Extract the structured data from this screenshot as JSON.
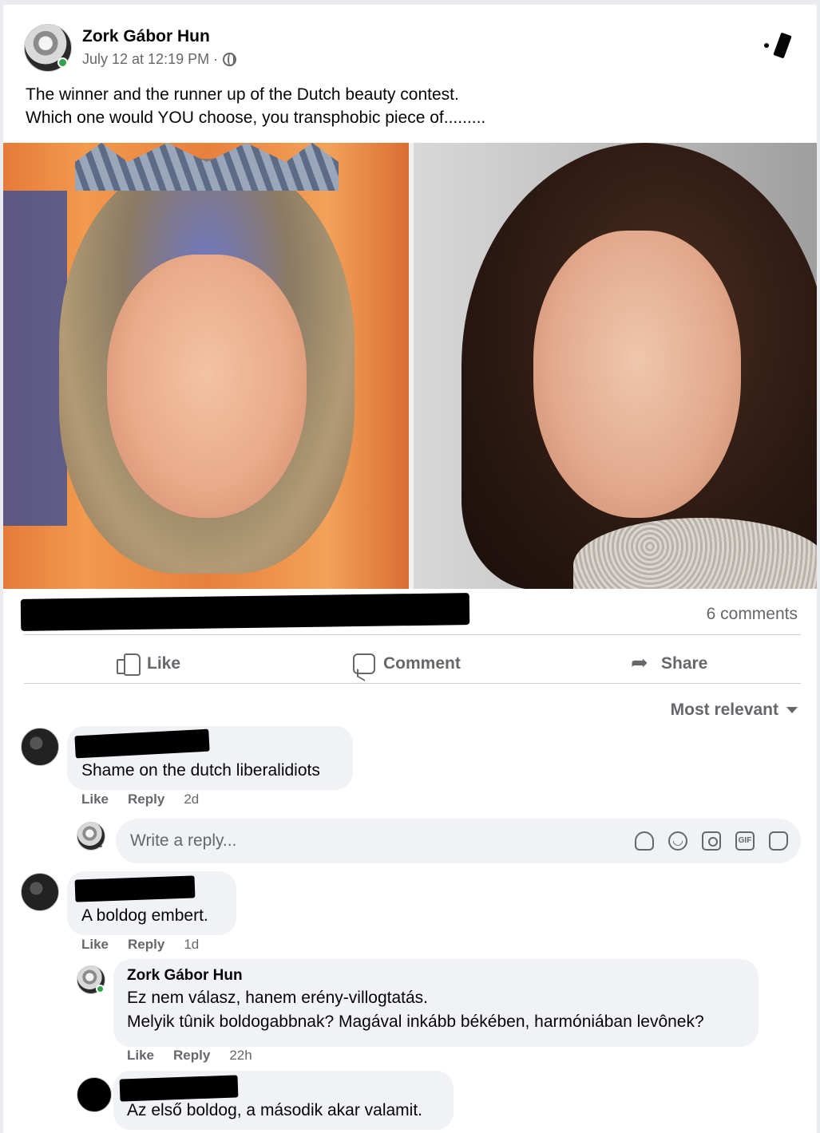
{
  "post": {
    "author": "Zork Gábor Hun",
    "timestamp": "July 12 at 12:19 PM ·",
    "privacy_icon": "globe-icon",
    "text_line1": "The winner and the runner up of the Dutch beauty contest.",
    "text_line2": "Which one would YOU choose, you transphobic piece of.........",
    "comments_count": "6 comments"
  },
  "actions": {
    "like": "Like",
    "comment": "Comment",
    "share": "Share"
  },
  "sort": {
    "label": "Most relevant"
  },
  "comments": [
    {
      "text": "Shame on the dutch liberalidiots",
      "like": "Like",
      "reply": "Reply",
      "time": "2d"
    },
    {
      "text": "A boldog embert.",
      "like": "Like",
      "reply": "Reply",
      "time": "1d"
    }
  ],
  "reply_box": {
    "placeholder": "Write a reply..."
  },
  "nested_reply": {
    "author": "Zork Gábor Hun",
    "line1": "Ez nem válasz, hanem erény-villogtatás.",
    "line2": "Melyik tûnik boldogabbnak? Magával inkább békében, harmóniában levônek?",
    "like": "Like",
    "reply": "Reply",
    "time": "22h"
  },
  "last_reply": {
    "text": "Az első boldog, a második akar valamit."
  },
  "colors": {
    "secondary_text": "#65676b",
    "bubble_bg": "#f0f2f5",
    "online_green": "#31a24c"
  }
}
